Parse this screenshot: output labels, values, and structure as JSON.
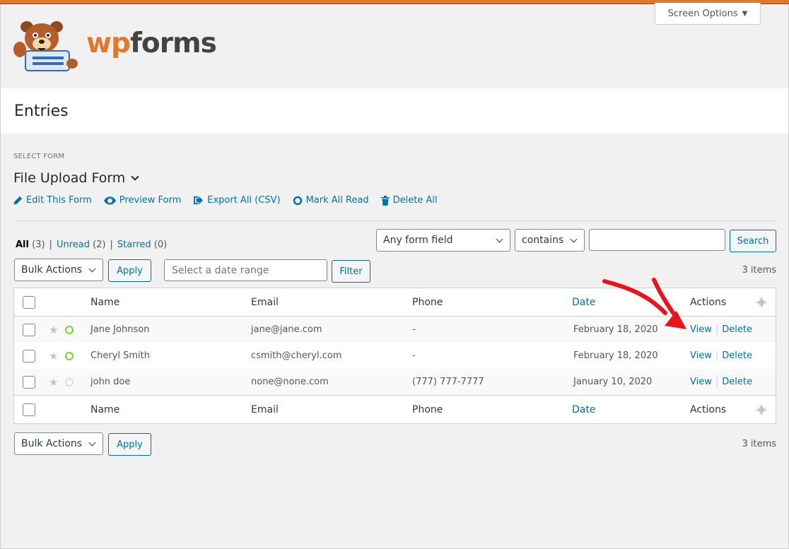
{
  "header": {
    "screen_options": "Screen Options",
    "logo_wp": "wp",
    "logo_forms": "forms"
  },
  "page": {
    "title": "Entries"
  },
  "form_selector": {
    "label": "SELECT FORM",
    "value": "File Upload Form"
  },
  "form_actions": {
    "edit": "Edit This Form",
    "preview": "Preview Form",
    "export": "Export All (CSV)",
    "mark_read": "Mark All Read",
    "delete_all": "Delete All"
  },
  "views": {
    "all": "All",
    "all_count": "(3)",
    "unread": "Unread",
    "unread_count": "(2)",
    "starred": "Starred",
    "starred_count": "(0)",
    "separator": "|"
  },
  "search": {
    "field": "Any form field",
    "operator": "contains",
    "value": "",
    "button": "Search"
  },
  "bulk": {
    "label": "Bulk Actions",
    "apply": "Apply"
  },
  "date_filter": {
    "placeholder": "Select a date range",
    "button": "Filter"
  },
  "items_count": "3 items",
  "table": {
    "columns": {
      "name": "Name",
      "email": "Email",
      "phone": "Phone",
      "date": "Date",
      "actions": "Actions"
    },
    "action_view": "View",
    "action_delete": "Delete",
    "rows": [
      {
        "name": "Jane Johnson",
        "email": "jane@jane.com",
        "phone": "-",
        "date": "February 18, 2020",
        "starred": false,
        "unread": true
      },
      {
        "name": "Cheryl Smith",
        "email": "csmith@cheryl.com",
        "phone": "-",
        "date": "February 18, 2020",
        "starred": false,
        "unread": true
      },
      {
        "name": "john doe",
        "email": "none@none.com",
        "phone": "(777) 777-7777",
        "date": "January 10, 2020",
        "starred": false,
        "unread": false
      }
    ]
  },
  "colors": {
    "accent": "#0073aa",
    "brand": "#e27730",
    "arrow": "#e8141b",
    "unread_dot": "#7ad03a"
  }
}
